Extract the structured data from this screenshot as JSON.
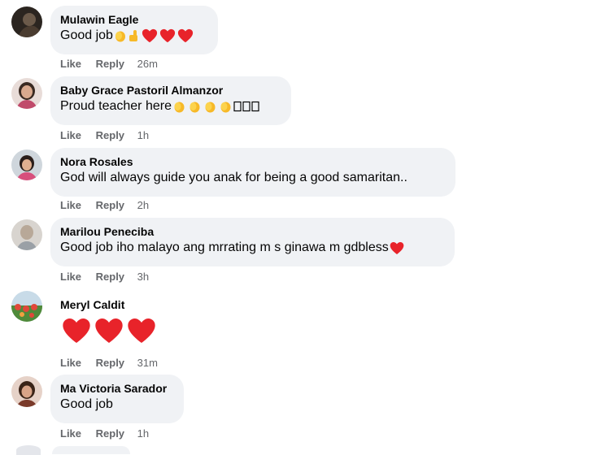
{
  "actions": {
    "like": "Like",
    "reply": "Reply"
  },
  "comments": [
    {
      "author": "Mulawin Eagle",
      "text": "Good job",
      "time": "26m",
      "emojis": [
        "clap-icon",
        "thumbs-up-icon",
        "heart-icon",
        "heart-icon",
        "heart-icon"
      ]
    },
    {
      "author": "Baby Grace Pastoril Almanzor",
      "text": "Proud teacher here",
      "time": "1h",
      "emojis": [
        "clap-icon",
        "clap-icon",
        "clap-icon",
        "clap-icon",
        "missing-glyph",
        "missing-glyph",
        "missing-glyph"
      ]
    },
    {
      "author": "Nora Rosales",
      "text": "God will always guide you anak for being a good samaritan..",
      "time": "2h",
      "emojis": []
    },
    {
      "author": "Marilou Peneciba",
      "text": "Good job iho malayo ang mrrating m s ginawa m gdbless",
      "time": "3h",
      "emojis": [
        "heart-icon"
      ]
    },
    {
      "author": "Meryl Caldit",
      "text": "",
      "time": "31m",
      "emojis": [
        "heart-icon",
        "heart-icon",
        "heart-icon"
      ]
    },
    {
      "author": "Ma Victoria Sarador",
      "text": "Good job",
      "time": "1h",
      "emojis": []
    }
  ],
  "colors": {
    "bubble": "#f0f2f5",
    "secondary_text": "#65676b",
    "heart": "#e8232a",
    "clap": "#f7b928"
  }
}
